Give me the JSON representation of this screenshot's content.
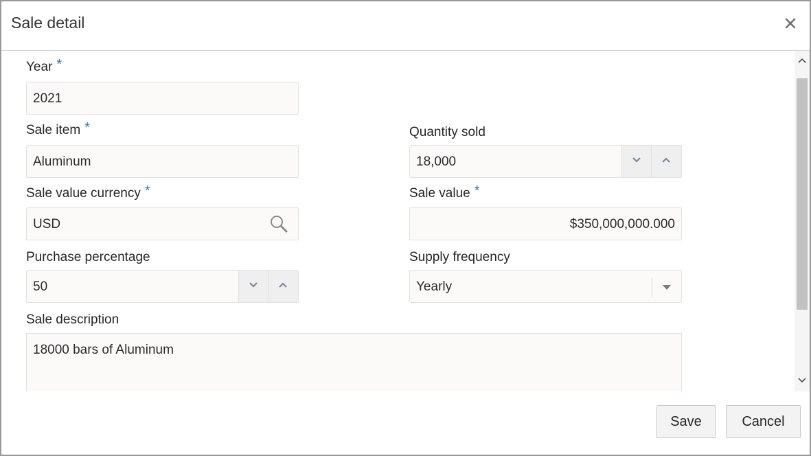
{
  "dialog": {
    "title": "Sale detail",
    "close_icon": "close-icon"
  },
  "form": {
    "year": {
      "label": "Year",
      "required": "*",
      "value": "2021"
    },
    "sale_item": {
      "label": "Sale item",
      "required": "*",
      "value": "Aluminum"
    },
    "quantity_sold": {
      "label": "Quantity sold",
      "value": "18,000"
    },
    "sale_value_currency": {
      "label": "Sale value currency",
      "required": "*",
      "value": "USD",
      "icon": "search-icon"
    },
    "sale_value": {
      "label": "Sale value",
      "required": "*",
      "value": "$350,000,000.000"
    },
    "purchase_percentage": {
      "label": "Purchase percentage",
      "value": "50"
    },
    "supply_frequency": {
      "label": "Supply frequency",
      "value": "Yearly"
    },
    "sale_description": {
      "label": "Sale description",
      "value": "18000 bars of Aluminum"
    }
  },
  "footer": {
    "save_label": "Save",
    "cancel_label": "Cancel"
  },
  "colors": {
    "accent": "#2a7ab8",
    "field_bg": "#fcf9f9",
    "border": "#9a9a9a"
  }
}
